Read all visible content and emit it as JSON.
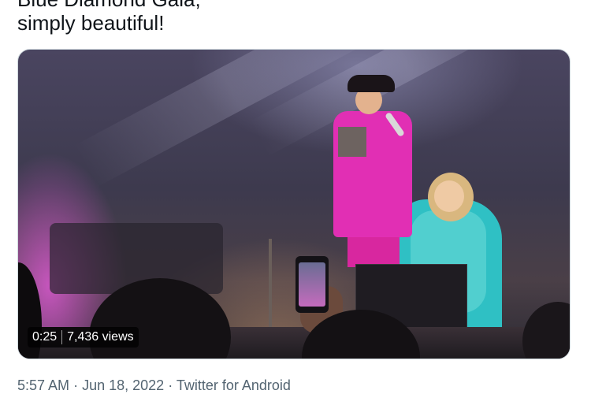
{
  "tweet": {
    "text_lines": [
      "Blue Diamond Gala,",
      "simply beautiful!"
    ]
  },
  "video": {
    "duration": "0:25",
    "views": "7,436 views"
  },
  "meta": {
    "time": "5:57 AM",
    "separator": "·",
    "date": "Jun 18, 2022",
    "source": "Twitter for Android"
  },
  "colors": {
    "text": "#0f1419",
    "secondary": "#536471",
    "border": "#cfd9de"
  }
}
